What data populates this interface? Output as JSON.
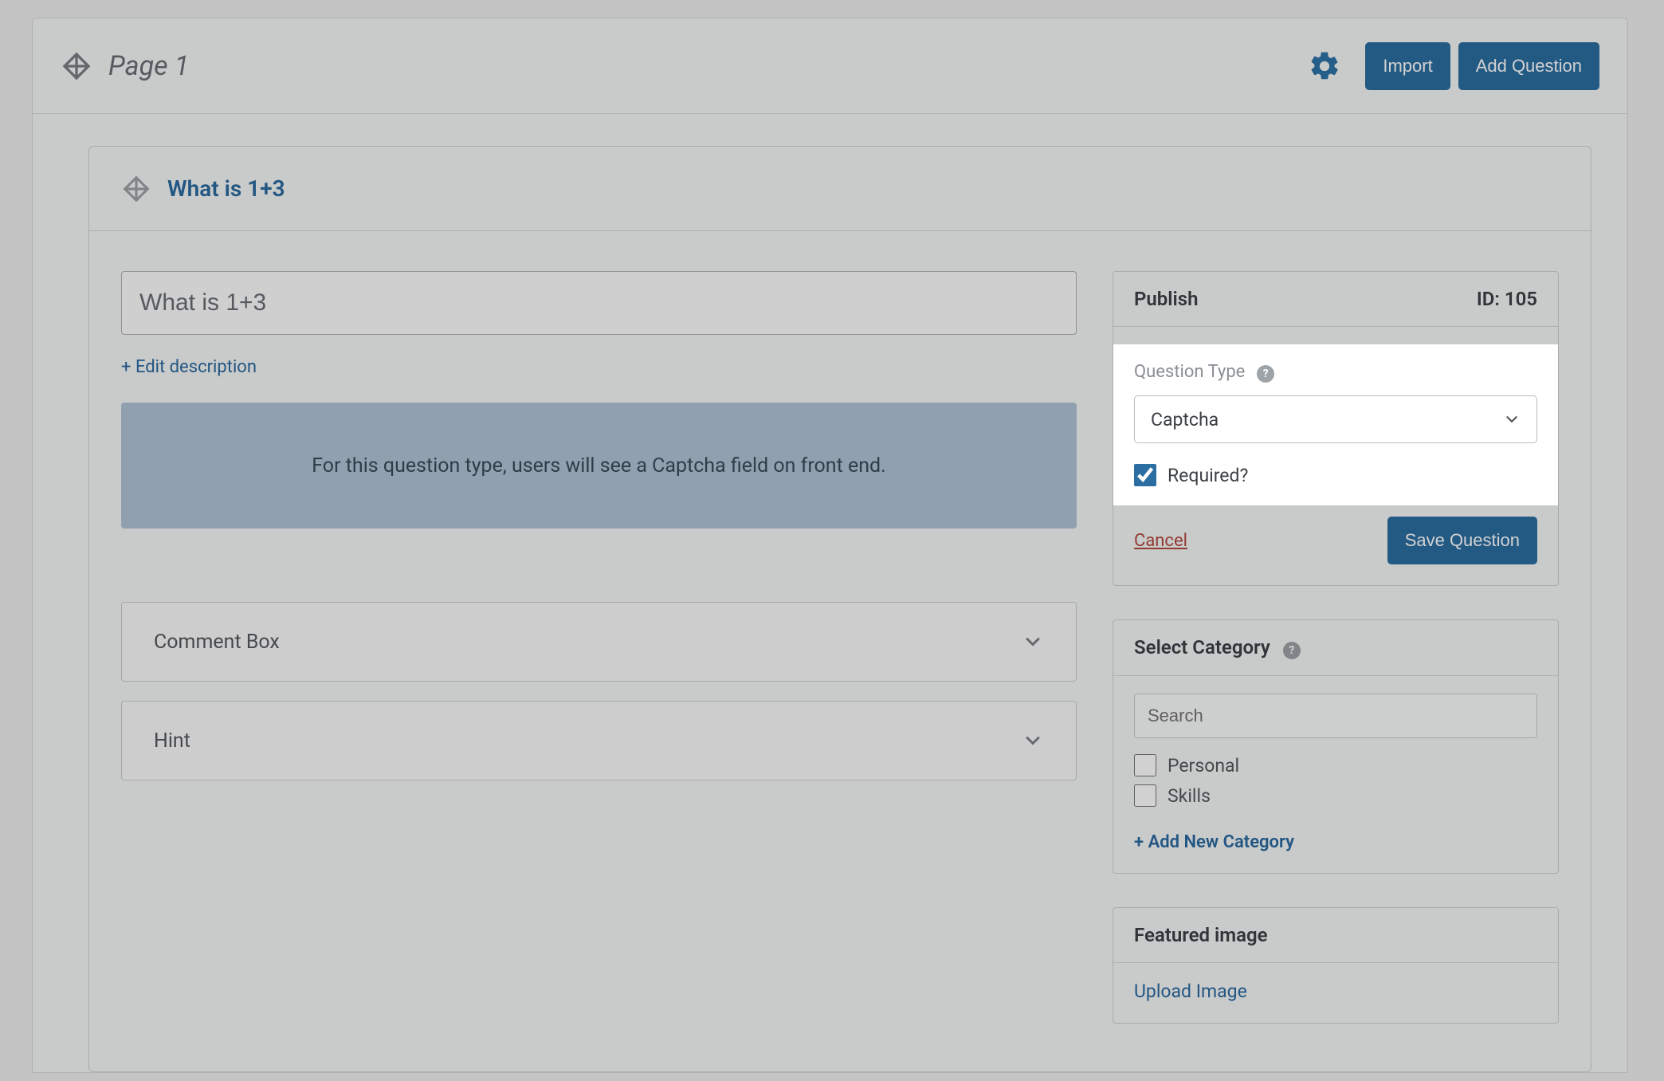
{
  "page": {
    "title": "Page 1",
    "import_label": "Import",
    "add_question_label": "Add Question"
  },
  "question": {
    "header_title": "What is 1+3",
    "title_value": "What is 1+3",
    "edit_description_label": "+ Edit description",
    "info_banner": "For this question type, users will see a Captcha field on front end.",
    "accordion": {
      "comment_box": "Comment Box",
      "hint": "Hint"
    }
  },
  "publish_box": {
    "title": "Publish",
    "id_label": "ID: 105",
    "question_type_label": "Question Type",
    "question_type_value": "Captcha",
    "required_label": "Required?",
    "required_checked": true,
    "cancel_label": "Cancel",
    "save_label": "Save Question"
  },
  "category_box": {
    "title": "Select Category",
    "search_placeholder": "Search",
    "items": [
      "Personal",
      "Skills"
    ],
    "add_new_label": "+ Add New Category"
  },
  "featured_box": {
    "title": "Featured image",
    "upload_label": "Upload Image"
  }
}
